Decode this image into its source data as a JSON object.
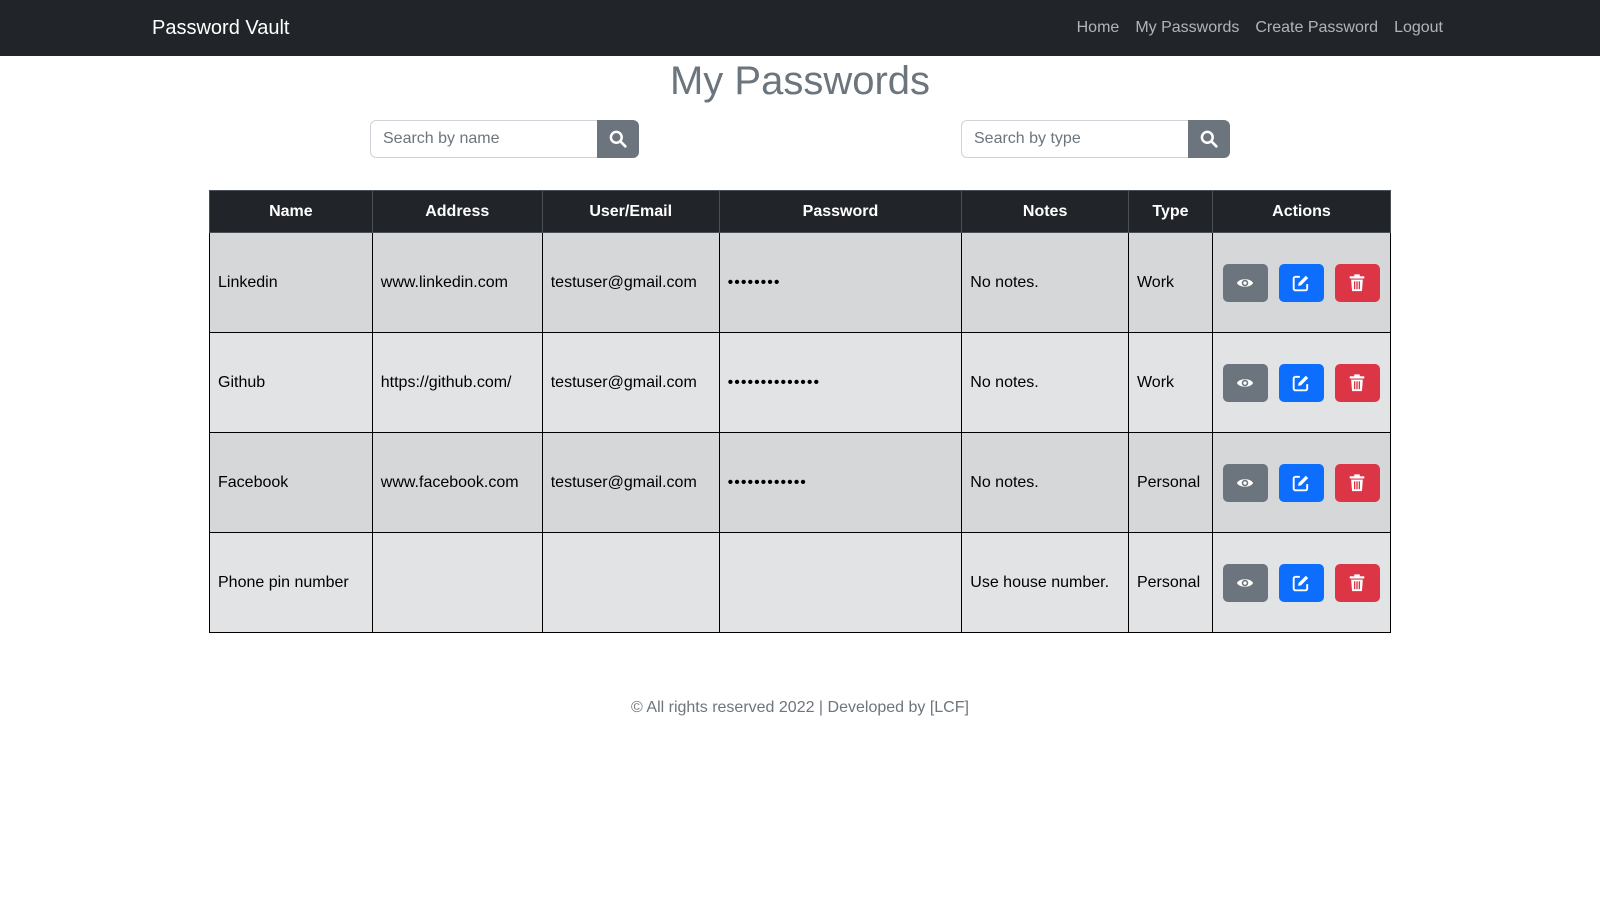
{
  "navbar": {
    "brand": "Password Vault",
    "links": [
      "Home",
      "My Passwords",
      "Create Password",
      "Logout"
    ]
  },
  "page": {
    "title": "My Passwords"
  },
  "search": {
    "name_placeholder": "Search by name",
    "type_placeholder": "Search by type",
    "icon": "search-icon"
  },
  "table": {
    "headers": [
      "Name",
      "Address",
      "User/Email",
      "Password",
      "Notes",
      "Type",
      "Actions"
    ],
    "rows": [
      {
        "name": "Linkedin",
        "address": "www.linkedin.com",
        "user": "testuser@gmail.com",
        "password": "••••••••",
        "notes": "No notes.",
        "type": "Work"
      },
      {
        "name": "Github",
        "address": "https://github.com/",
        "user": "testuser@gmail.com",
        "password": "••••••••••••••",
        "notes": "No notes.",
        "type": "Work"
      },
      {
        "name": "Facebook",
        "address": "www.facebook.com",
        "user": "testuser@gmail.com",
        "password": "••••••••••••",
        "notes": "No notes.",
        "type": "Personal"
      },
      {
        "name": "Phone pin number",
        "address": "",
        "user": "",
        "password": "",
        "notes": "Use house number.",
        "type": "Personal"
      }
    ],
    "action_icons": [
      "eye-icon",
      "edit-icon",
      "trash-icon"
    ]
  },
  "colors": {
    "navbar": "#212529",
    "secondary": "#6c757d",
    "primary": "#0d6efd",
    "danger": "#dc3545"
  },
  "footer": {
    "text": "© All rights reserved 2022 | Developed by [LCF]"
  }
}
